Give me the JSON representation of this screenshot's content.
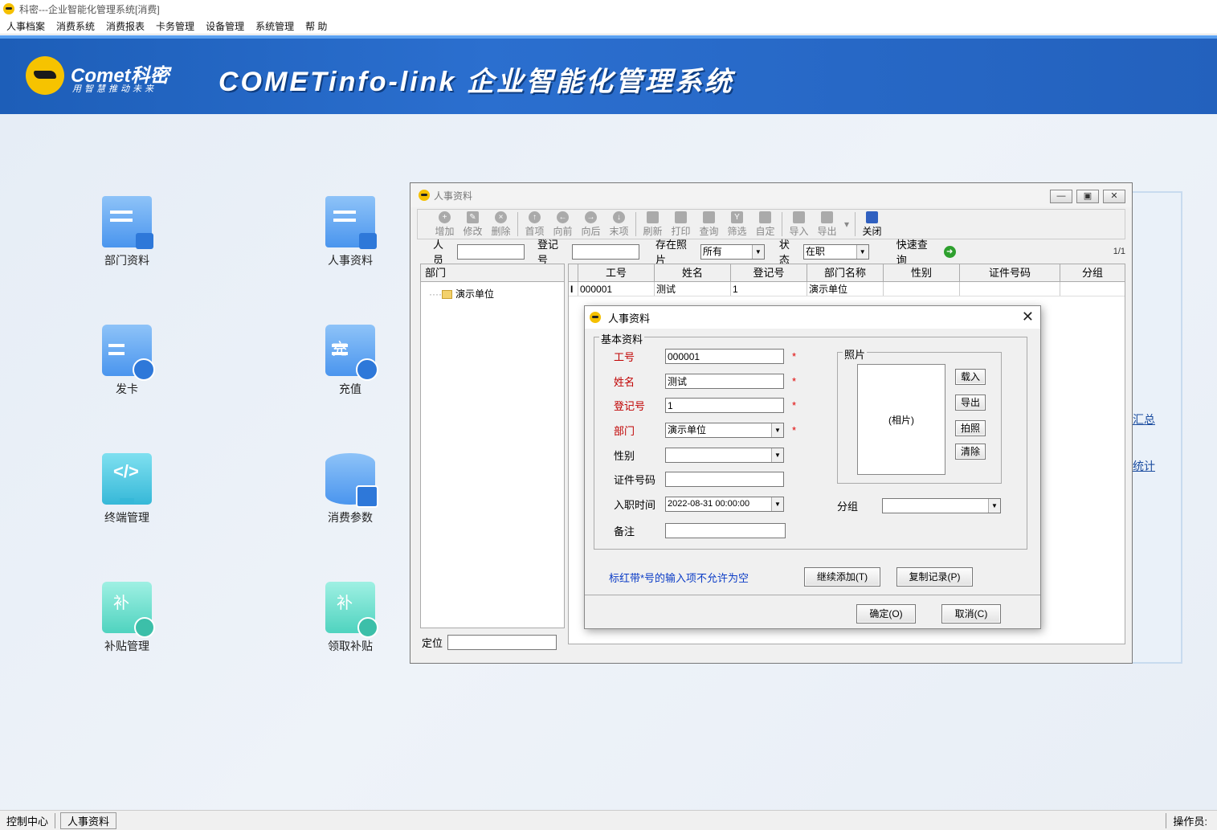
{
  "app": {
    "title": "科密---企业智能化管理系统[消费]"
  },
  "menu": [
    "人事档案",
    "消费系统",
    "消费报表",
    "卡务管理",
    "设备管理",
    "系统管理",
    "帮 助"
  ],
  "banner": {
    "brand": "Comet科密",
    "slogan": "用智慧推动未来",
    "title": "COMETinfo-link 企业智能化管理系统",
    "color": "#2263c4"
  },
  "tiles": [
    {
      "label": "部门资料",
      "icon": "department-doc-icon"
    },
    {
      "label": "人事资料",
      "icon": "personnel-doc-icon"
    },
    {
      "label": "发卡",
      "icon": "issue-card-icon"
    },
    {
      "label": "充值",
      "icon": "recharge-card-icon",
      "glyph": "充"
    },
    {
      "label": "终端管理",
      "icon": "terminal-monitor-icon",
      "glyph": "</>"
    },
    {
      "label": "消费参数",
      "icon": "consumption-db-icon"
    },
    {
      "label": "补贴管理",
      "icon": "subsidy-ticket-icon",
      "glyph": "补"
    },
    {
      "label": "领取补贴",
      "icon": "receive-subsidy-icon",
      "glyph": "补"
    }
  ],
  "bgpanel": {
    "items": [
      "汇总",
      "统计"
    ]
  },
  "window": {
    "title": "人事资料",
    "toolbar": [
      "增加",
      "修改",
      "删除",
      "首项",
      "向前",
      "向后",
      "末项",
      "刷新",
      "打印",
      "查询",
      "筛选",
      "自定",
      "导入",
      "导出",
      "关闭"
    ],
    "filter": {
      "person_label": "人员",
      "person_value": "",
      "regno_label": "登记号",
      "regno_value": "",
      "photo_label": "存在照片",
      "photo_value": "所有",
      "status_label": "状态",
      "status_value": "在职",
      "quick_label": "快速查询",
      "page": "1/1"
    },
    "tree": {
      "header": "部门",
      "item": "演示单位"
    },
    "locate_label": "定位",
    "grid": {
      "columns": [
        "工号",
        "姓名",
        "登记号",
        "部门名称",
        "性别",
        "证件号码",
        "分组"
      ],
      "rows": [
        [
          "000001",
          "测试",
          "1",
          "演示单位",
          "",
          "",
          ""
        ]
      ]
    }
  },
  "dialog": {
    "title": "人事资料",
    "group_label": "基本资料",
    "fields": {
      "empno": {
        "label": "工号",
        "value": "000001"
      },
      "name": {
        "label": "姓名",
        "value": "测试"
      },
      "regno": {
        "label": "登记号",
        "value": "1"
      },
      "dept": {
        "label": "部门",
        "value": "演示单位"
      },
      "gender": {
        "label": "性别",
        "value": ""
      },
      "idno": {
        "label": "证件号码",
        "value": ""
      },
      "hire": {
        "label": "入职时间",
        "value": "2022-08-31 00:00:00"
      },
      "remark": {
        "label": "备注",
        "value": ""
      }
    },
    "photo": {
      "label": "照片",
      "placeholder": "(相片)",
      "buttons": [
        "载入",
        "导出",
        "拍照",
        "清除"
      ]
    },
    "group": {
      "label": "分组",
      "value": ""
    },
    "required_mark": "*",
    "hint": "标红带*号的输入项不允许为空",
    "buttons": {
      "continue": "继续添加(T)",
      "copy": "复制记录(P)",
      "ok": "确定(O)",
      "cancel": "取消(C)"
    }
  },
  "statusbar": {
    "items": [
      "控制中心",
      "人事资料"
    ],
    "operator": "操作员:"
  }
}
